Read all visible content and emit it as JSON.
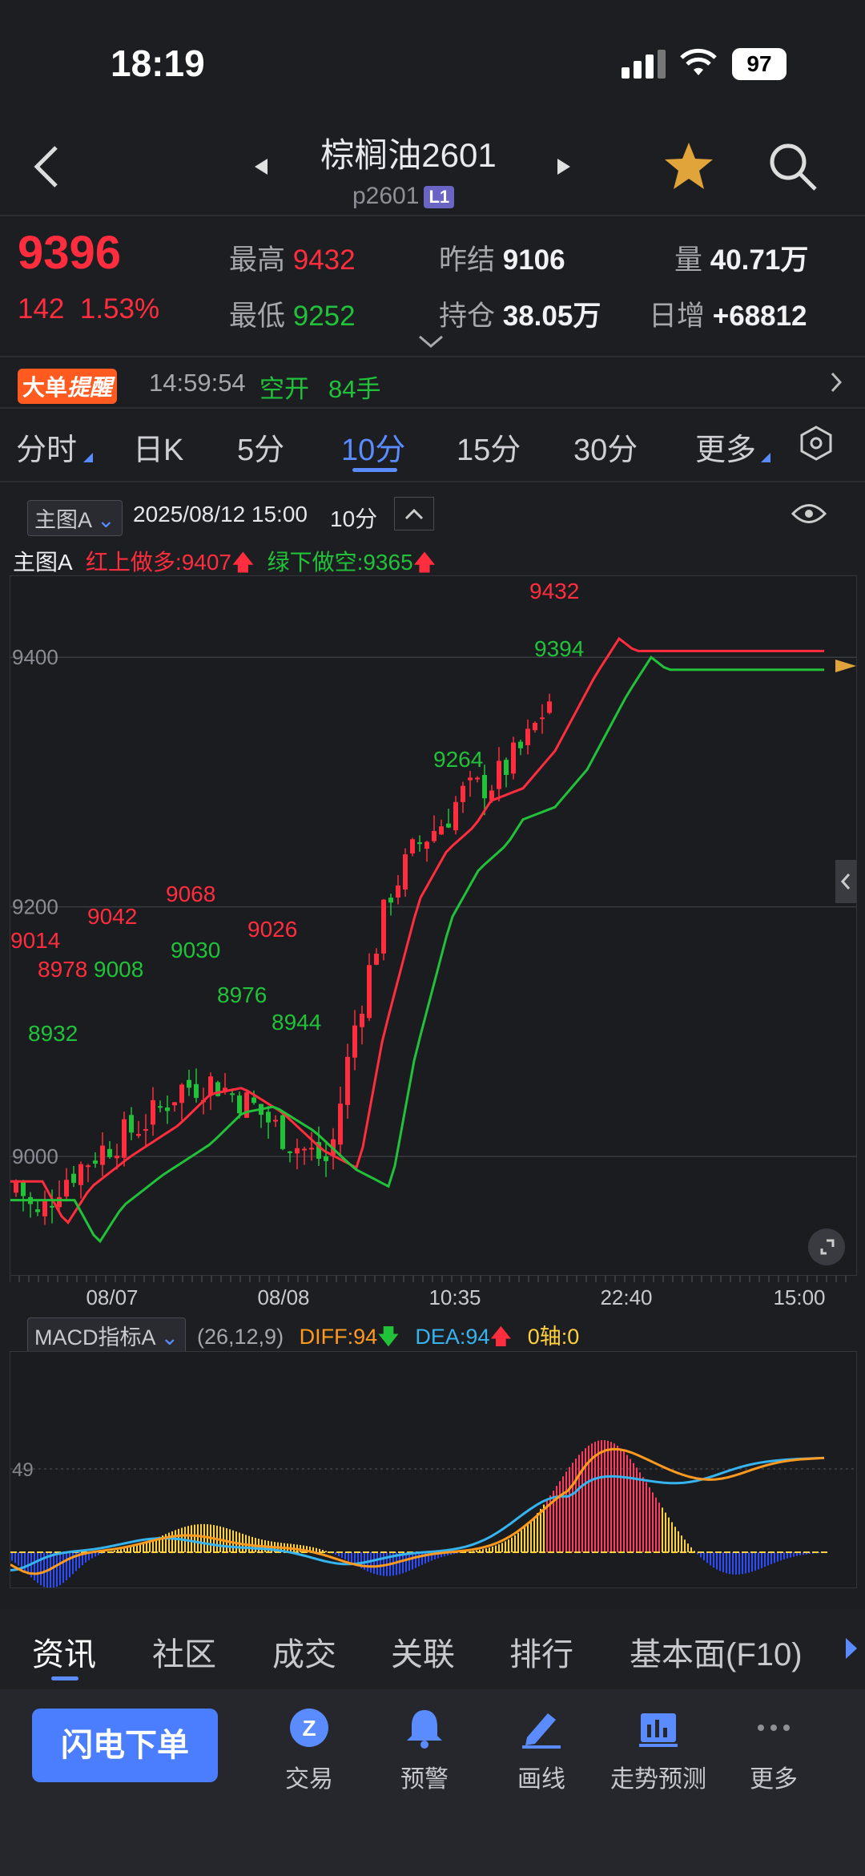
{
  "status": {
    "time": "18:19",
    "battery": "97"
  },
  "nav": {
    "title": "棕榈油2601",
    "code": "p2601",
    "level": "L1"
  },
  "quote": {
    "last": "9396",
    "change": "142",
    "change_pct": "1.53%",
    "high_label": "最高",
    "high": "9432",
    "low_label": "最低",
    "low": "9252",
    "prev_settle_label": "昨结",
    "prev_settle": "9106",
    "open_interest_label": "持仓",
    "open_interest": "38.05万",
    "volume_label": "量",
    "volume": "40.71万",
    "daily_inc_label": "日增",
    "daily_inc": "+68812"
  },
  "alert": {
    "badge_a": "大单",
    "badge_b": "提醒",
    "time": "14:59:54",
    "action": "空开",
    "qty": "84手"
  },
  "period_tabs": [
    "分时",
    "日K",
    "5分",
    "10分",
    "15分",
    "30分",
    "更多"
  ],
  "active_tab": "10分",
  "chart_header": {
    "selector": "主图A",
    "datetime": "2025/08/12 15:00",
    "period": "10分"
  },
  "indicator_line": {
    "name": "主图A",
    "up_label": "红上做多:",
    "up_value": "9407",
    "down_label": "绿下做空:",
    "down_value": "9365"
  },
  "chart_data": {
    "type": "candlestick",
    "y_ticks": [
      "9400",
      "9200",
      "9000"
    ],
    "ylim": [
      8905,
      9465
    ],
    "x_labels": [
      "08/07",
      "08/08",
      "10:35",
      "22:40",
      "15:00"
    ],
    "annotations": [
      "9432",
      "9394",
      "9264",
      "9068",
      "9042",
      "9014",
      "9026",
      "9030",
      "9008",
      "8978",
      "8976",
      "8944",
      "8932"
    ],
    "colors": {
      "up": "#ff2d3d",
      "down": "#21c23a",
      "red_line": "#ff2d3d",
      "green_line": "#21c23a"
    }
  },
  "macd": {
    "selector": "MACD指标A",
    "params": "(26,12,9)",
    "diff_label": "DIFF:94",
    "dea_label": "DEA:94",
    "axis_label": "0轴:0",
    "y_tick": "49"
  },
  "bottom_tabs": [
    "资讯",
    "社区",
    "成交",
    "关联",
    "排行",
    "基本面(F10)"
  ],
  "toolbar": {
    "flash_order": "闪电下单",
    "items": [
      "交易",
      "预警",
      "画线",
      "走势预测",
      "更多"
    ]
  }
}
